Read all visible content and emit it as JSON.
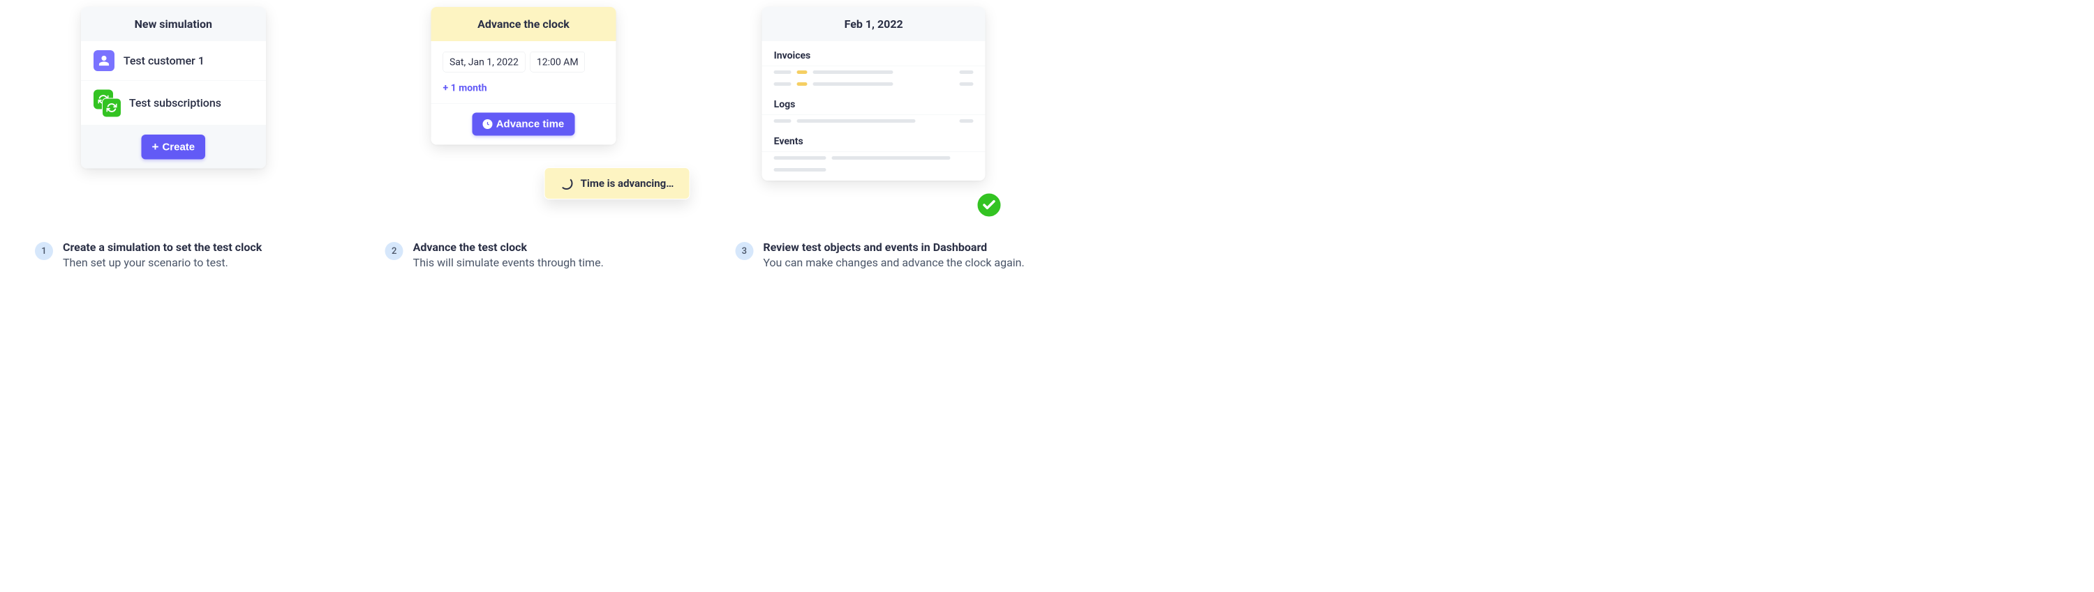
{
  "card1": {
    "header": "New simulation",
    "customer_label": "Test customer 1",
    "subscriptions_label": "Test subscriptions",
    "create_button": "Create"
  },
  "card2": {
    "header": "Advance the clock",
    "date_field": "Sat, Jan 1, 2022",
    "time_field": "12:00 AM",
    "plus_link": "+ 1 month",
    "advance_button": "Advance time",
    "popover": "Time is advancing…"
  },
  "card3": {
    "header": "Feb 1, 2022",
    "section_invoices": "Invoices",
    "section_logs": "Logs",
    "section_events": "Events"
  },
  "step1": {
    "num": "1",
    "title": "Create a simulation to set the test clock",
    "sub": "Then set up your scenario to test."
  },
  "step2": {
    "num": "2",
    "title": "Advance the test clock",
    "sub": "This will simulate events through time."
  },
  "step3": {
    "num": "3",
    "title": "Review test objects and events in Dashboard",
    "sub": "You can make changes and advance the clock again."
  }
}
